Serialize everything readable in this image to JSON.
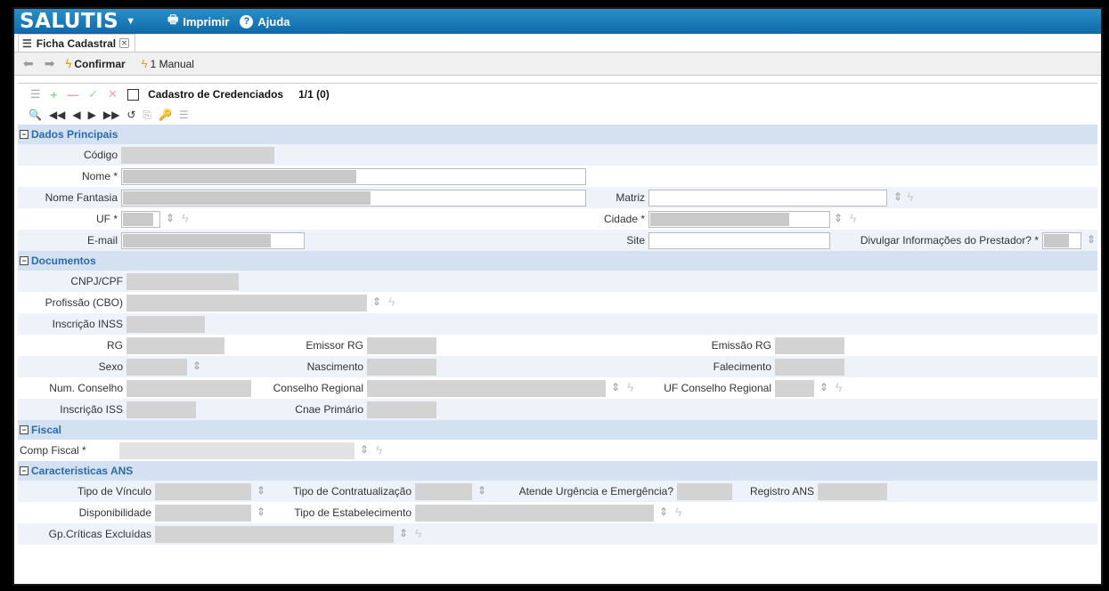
{
  "app": {
    "brand": "SALUTIS",
    "print_label": "Imprimir",
    "help_label": "Ajuda"
  },
  "tab": {
    "label": "Ficha Cadastral"
  },
  "actions": {
    "confirm_label": "Confirmar",
    "manual_label": "1 Manual"
  },
  "record": {
    "title": "Cadastro de Credenciados",
    "counter": "1/1 (0)"
  },
  "sections": {
    "main": "Dados Principais",
    "documents": "Documentos",
    "fiscal": "Fiscal",
    "ans": "Caracteristicas ANS"
  },
  "labels": {
    "codigo": "Código",
    "nome": "Nome *",
    "nome_fantasia": "Nome Fantasia",
    "matriz": "Matriz",
    "uf": "UF *",
    "cidade": "Cidade *",
    "email": "E-mail",
    "site": "Site",
    "divulgar": "Divulgar Informações do Prestador? *",
    "cnpj": "CNPJ/CPF",
    "profissao": "Profissão (CBO)",
    "inss": "Inscrição INSS",
    "rg": "RG",
    "emissor_rg": "Emissor RG",
    "emissao_rg": "Emissão RG",
    "sexo": "Sexo",
    "nascimento": "Nascimento",
    "falecimento": "Falecimento",
    "num_conselho": "Num. Conselho",
    "conselho_regional": "Conselho Regional",
    "uf_conselho": "UF Conselho Regional",
    "inscricao_iss": "Inscrição ISS",
    "cnae": "Cnae Primário",
    "comp_fiscal": "Comp Fiscal *",
    "tipo_vinculo": "Tipo de Vínculo",
    "tipo_contrat": "Tipo de Contratualização",
    "urgencia": "Atende Urgência e Emergência?",
    "registro_ans": "Registro ANS",
    "disponibilidade": "Disponibilidade",
    "tipo_estab": "Tipo de Estabelecimento",
    "gp_criticas": "Gp.Críticas Excluídas"
  },
  "icons": {
    "spin": "⇕",
    "bolt": "ϟ"
  },
  "colors": {
    "topbar": "#0d6aa8",
    "section_bg": "#d4e1f0",
    "section_text": "#2a6bb0",
    "bolt": "#e6a800"
  }
}
